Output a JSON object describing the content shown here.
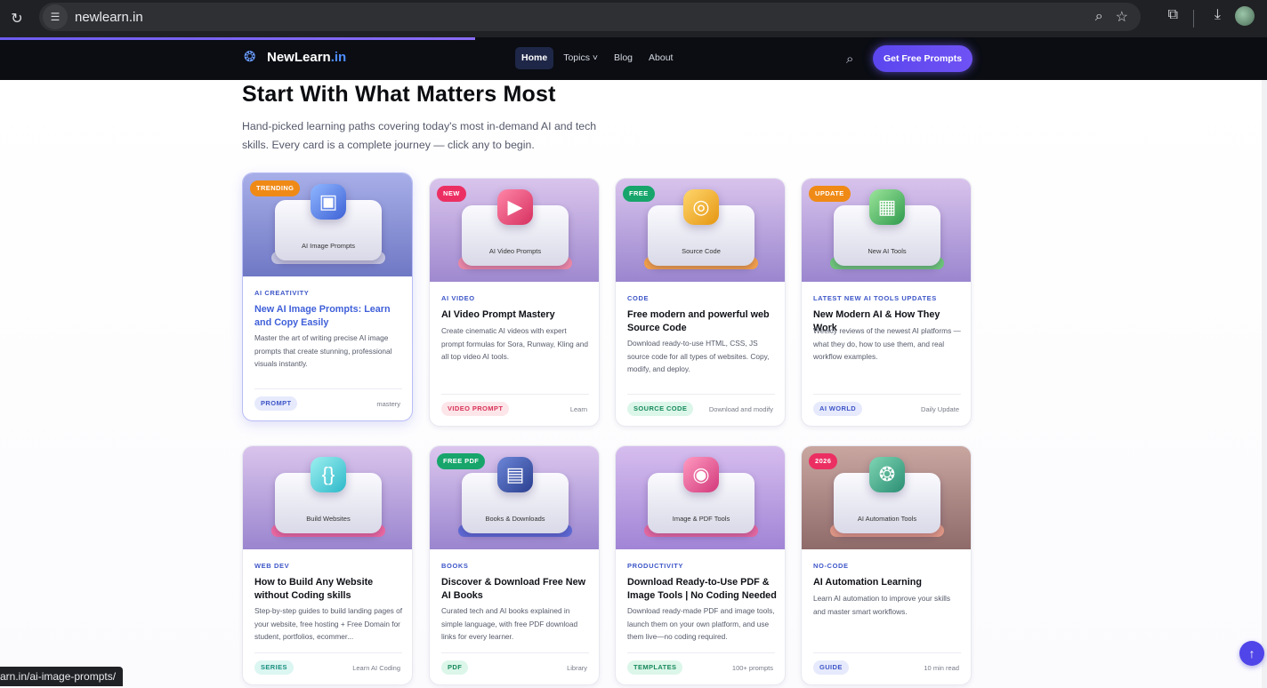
{
  "browser": {
    "url": "newlearn.in",
    "status_url": "arn.in/ai-image-prompts/"
  },
  "nav": {
    "brand": "NewLearn",
    "brand_tld": ".in",
    "items": [
      {
        "label": "Home",
        "active": true
      },
      {
        "label": "Topics ˅",
        "active": false
      },
      {
        "label": "Blog",
        "active": false
      },
      {
        "label": "About",
        "active": false
      }
    ],
    "cta_label": "Get Free Prompts"
  },
  "hero": {
    "title": "Start With What Matters Most",
    "lede": "Hand-picked learning paths covering today's most in-demand AI and tech skills. Every card is a complete journey — click any to begin."
  },
  "cards": [
    {
      "badge": "TRENDING",
      "badge_color": "#f08a16",
      "tile_label": "AI Image Prompts",
      "kicker": "AI CREATIVITY",
      "title": "New AI Image Prompts: Learn and Copy Easily",
      "desc": "Master the art of writing precise AI image prompts that create stunning, professional visuals instantly.",
      "tag": "PROMPT",
      "tag_bg": "#e6eafc",
      "tag_fg": "#3e55c7",
      "meta": "mastery",
      "icon": "image-icon"
    },
    {
      "badge": "NEW",
      "badge_color": "#ec2f63",
      "tile_label": "AI Video Prompts",
      "kicker": "AI VIDEO",
      "title": "AI Video Prompt Mastery",
      "desc": "Create cinematic AI videos with expert prompt formulas for Sora, Runway, Kling and all top video AI tools.",
      "tag": "VIDEO PROMPT",
      "tag_bg": "#fde6ea",
      "tag_fg": "#d83257",
      "meta": "Learn",
      "icon": "video-camera-icon"
    },
    {
      "badge": "FREE",
      "badge_color": "#17a56b",
      "tile_label": "Source Code",
      "kicker": "CODE",
      "title": "Free modern and powerful web Source Code",
      "desc": "Download ready-to-use HTML, CSS, JS source code for all types of websites. Copy, modify, and deploy.",
      "tag": "SOURCE CODE",
      "tag_bg": "#dcf6ea",
      "tag_fg": "#178a5a",
      "meta": "Download and modify",
      "icon": "coin-stack-icon"
    },
    {
      "badge": "UPDATE",
      "badge_color": "#f08a16",
      "tile_label": "New AI Tools",
      "kicker": "LATEST NEW AI TOOLS UPDATES",
      "title": "New Modern AI & How They Work",
      "desc": "Weekly reviews of the newest AI platforms — what they do, how to use them, and real workflow examples.",
      "tag": "AI WORLD",
      "tag_bg": "#e6eafc",
      "tag_fg": "#3e55c7",
      "meta": "Daily Update",
      "icon": "chip-icon"
    },
    {
      "badge": "",
      "badge_color": "",
      "tile_label": "Build Websites",
      "kicker": "WEB DEV",
      "title": "How to Build Any Website without Coding skills",
      "desc": "Step-by-step guides to build landing pages of your website, free hosting + Free Domain for student, portfolios, ecommer...",
      "tag": "SERIES",
      "tag_bg": "#dcf6f2",
      "tag_fg": "#1a8f80",
      "meta": "Learn AI Coding",
      "icon": "code-braces-icon"
    },
    {
      "badge": "FREE PDF",
      "badge_color": "#17a56b",
      "tile_label": "Books & Downloads",
      "kicker": "BOOKS",
      "title": "Discover & Download Free New AI Books",
      "desc": "Curated tech and AI books explained in simple language, with free PDF download links for every learner.",
      "tag": "PDF",
      "tag_bg": "#dcf6ea",
      "tag_fg": "#178a5a",
      "meta": "Library",
      "icon": "book-icon"
    },
    {
      "badge": "",
      "badge_color": "",
      "tile_label": "Image & PDF Tools",
      "kicker": "PRODUCTIVITY",
      "title": "Download Ready-to-Use PDF & Image Tools | No Coding Needed",
      "desc": "Download ready-made PDF and image tools, launch them on your own platform, and use them live—no coding required.",
      "tag": "TEMPLATES",
      "tag_bg": "#dcf6ea",
      "tag_fg": "#178a5a",
      "meta": "100+ prompts",
      "icon": "camera-icon"
    },
    {
      "badge": "2026",
      "badge_color": "#ec2f63",
      "tile_label": "AI Automation Tools",
      "kicker": "NO-CODE",
      "title": "AI Automation Learning",
      "desc": "Learn AI automation to improve your skills and master smart workflows.",
      "tag": "GUIDE",
      "tag_bg": "#e6eafc",
      "tag_fg": "#3e55c7",
      "meta": "10 min read",
      "icon": "automation-chip-icon"
    }
  ]
}
